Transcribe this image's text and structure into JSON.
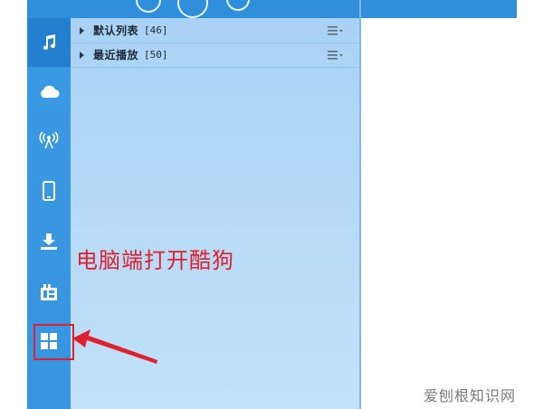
{
  "playlists": [
    {
      "name": "默认列表",
      "count": "[46]"
    },
    {
      "name": "最近播放",
      "count": "[50]"
    }
  ],
  "sidebar": {
    "items": [
      {
        "name": "music-note-icon",
        "active": true
      },
      {
        "name": "cloud-icon"
      },
      {
        "name": "radio-icon"
      },
      {
        "name": "phone-icon"
      },
      {
        "name": "download-icon"
      },
      {
        "name": "media-library-icon"
      },
      {
        "name": "apps-grid-icon"
      }
    ]
  },
  "annotation": {
    "text": "电脑端打开酷狗"
  },
  "watermark": {
    "text": "爱刨根知识网"
  },
  "colors": {
    "sidebar": "#3794e0",
    "sidebar_active": "#257fd0",
    "panel": "#b7dbf8",
    "annotation": "#e0202e"
  }
}
